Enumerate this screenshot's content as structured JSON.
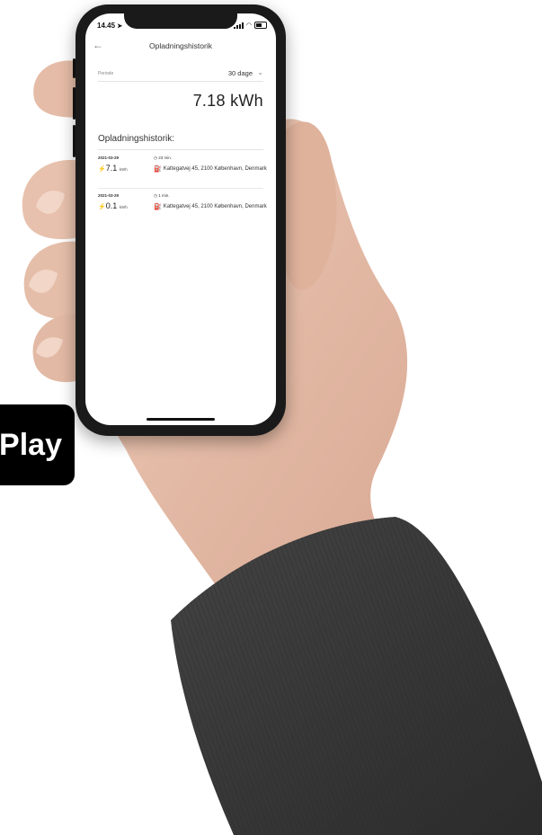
{
  "status_bar": {
    "time": "14.45"
  },
  "header": {
    "title": "Opladningshistorik"
  },
  "period": {
    "label": "Periode",
    "value": "30 dage"
  },
  "total_energy": "7.18 kWh",
  "history": {
    "title": "Opladningshistorik:",
    "entries": [
      {
        "date": "2021-03-29",
        "duration": "23 min.",
        "energy": "7.1",
        "unit": "kWh",
        "address": "Kattegatvej 45, 2100 København, Denmark"
      },
      {
        "date": "2021-03-29",
        "duration": "1 min.",
        "energy": "0.1",
        "unit": "kWh",
        "address": "Kattegatvej 45, 2100 København, Denmark"
      }
    ]
  },
  "store_badge": {
    "label": "Play"
  },
  "colors": {
    "screen_bg": "#ffffff",
    "phone_frame": "#1a1a1a",
    "sleeve": "#3a3a3a",
    "skin": "#e2b8a2"
  }
}
